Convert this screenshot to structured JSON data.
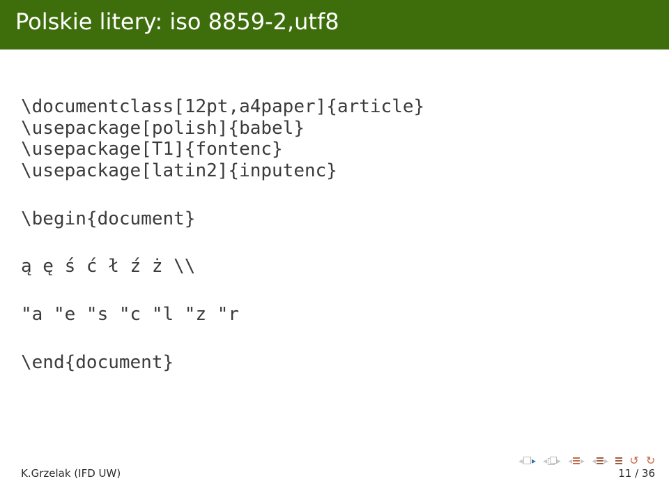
{
  "title": "Polskie litery: iso 8859-2,utf8",
  "code": {
    "preamble": [
      "\\documentclass[12pt,a4paper]{article}",
      "\\usepackage[polish]{babel}",
      "\\usepackage[T1]{fontenc}",
      "\\usepackage[latin2]{inputenc}"
    ],
    "begin": "\\begin{document}",
    "line1": "ą ę ś ć ł ź ż \\\\",
    "line2": "\"a \"e \"s \"c \"l \"z \"r",
    "end": "\\end{document}"
  },
  "footer": {
    "author": "K.Grzelak (IFD UW)",
    "page": "11 / 36"
  }
}
